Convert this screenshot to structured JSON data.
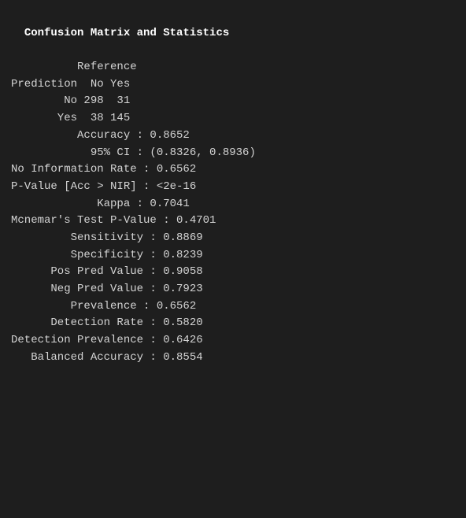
{
  "terminal": {
    "title": "Confusion Matrix and Statistics",
    "lines": [
      {
        "id": "blank1",
        "text": ""
      },
      {
        "id": "reference-header",
        "text": "          Reference"
      },
      {
        "id": "prediction-header",
        "text": "Prediction  No Yes"
      },
      {
        "id": "row-no",
        "text": "        No 298  31"
      },
      {
        "id": "row-yes",
        "text": "       Yes  38 145"
      },
      {
        "id": "blank2",
        "text": ""
      },
      {
        "id": "accuracy",
        "text": "          Accuracy : 0.8652"
      },
      {
        "id": "ci",
        "text": "            95% CI : (0.8326, 0.8936)"
      },
      {
        "id": "nir",
        "text": "No Information Rate : 0.6562"
      },
      {
        "id": "pvalue",
        "text": "P-Value [Acc > NIR] : <2e-16"
      },
      {
        "id": "blank3",
        "text": ""
      },
      {
        "id": "kappa",
        "text": "             Kappa : 0.7041"
      },
      {
        "id": "blank4",
        "text": ""
      },
      {
        "id": "mcnemar",
        "text": "Mcnemar's Test P-Value : 0.4701"
      },
      {
        "id": "blank5",
        "text": ""
      },
      {
        "id": "sensitivity",
        "text": "         Sensitivity : 0.8869"
      },
      {
        "id": "specificity",
        "text": "         Specificity : 0.8239"
      },
      {
        "id": "pos-pred",
        "text": "      Pos Pred Value : 0.9058"
      },
      {
        "id": "neg-pred",
        "text": "      Neg Pred Value : 0.7923"
      },
      {
        "id": "prevalence",
        "text": "         Prevalence : 0.6562"
      },
      {
        "id": "detection-rate",
        "text": "      Detection Rate : 0.5820"
      },
      {
        "id": "detection-prevalence",
        "text": "Detection Prevalence : 0.6426"
      },
      {
        "id": "balanced-accuracy",
        "text": "   Balanced Accuracy : 0.8554"
      }
    ]
  }
}
